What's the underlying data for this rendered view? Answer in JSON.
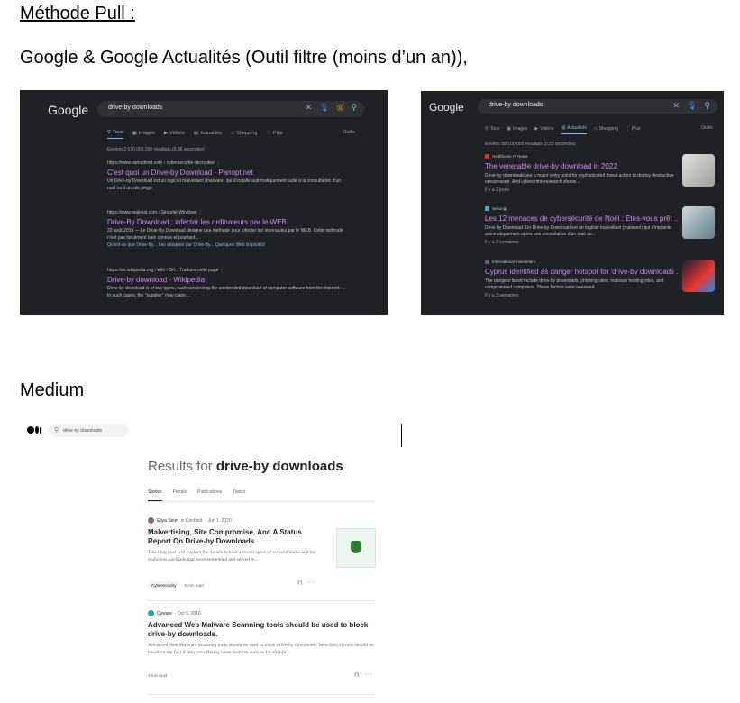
{
  "doc": {
    "title": "Méthode Pull :",
    "subtitle": "Google & Google Actualités (Outil filtre (moins d’un an)),",
    "medium_heading": "Medium"
  },
  "google_web": {
    "logo": "Google",
    "query": "drive-by downloads",
    "tabs": [
      {
        "icon": "search-icon",
        "label": "Tous",
        "active": true
      },
      {
        "icon": "image-icon",
        "label": "Images",
        "active": false
      },
      {
        "icon": "video-icon",
        "label": "Vidéos",
        "active": false
      },
      {
        "icon": "news-icon",
        "label": "Actualités",
        "active": false
      },
      {
        "icon": "tag-icon",
        "label": "Shopping",
        "active": false
      },
      {
        "icon": "more-icon",
        "label": "Plus",
        "active": false
      }
    ],
    "tools": "Outils",
    "count": "Environ 2 070 000 000 résultats (0,36 secondes)",
    "results": [
      {
        "source": "https://www.panoptinet.com › cybersecurite-decryptee   ⋮",
        "title": "C'est quoi un Drive-by Download - Panoptinet",
        "snippet": "Un Drive-by Download est un logiciel malveillant (malware) qui s'installe automatiquement suite à la consultation d'un mail ou d'un site piégé.",
        "links": ""
      },
      {
        "source": "https://www.malekal.com › Sécurité Windows   ⋮",
        "title": "Drive-By Download : infecter les ordinateurs par le WEB",
        "snippet": "29 août 2019 — Le Drive-By Download désigne une méthode pour infecter les internautes par le WEB. Cette méthode n'est pas forcément bien connue et pourtant ...",
        "links": "Qu'est-ce que Drive-By...   Les attaques par Drive-By...   Quelques Web ExploitKit"
      },
      {
        "source": "https://en.wikipedia.org › wiki › Dri...   Traduire cette page   ⋮",
        "title": "Drive-by download - Wikipedia",
        "snippet": "Drive-by download is of two types, each concerning the unintended download of computer software from the Internet: ... In such cases, the \"supplier\" may claim ...",
        "links": ""
      }
    ]
  },
  "google_news": {
    "logo": "Google",
    "query": "drive-by downloads",
    "tabs": [
      {
        "icon": "search-icon",
        "label": "Tous",
        "active": false
      },
      {
        "icon": "image-icon",
        "label": "Images",
        "active": false
      },
      {
        "icon": "video-icon",
        "label": "Vidéos",
        "active": false
      },
      {
        "icon": "news-icon",
        "label": "Actualités",
        "active": true
      },
      {
        "icon": "tag-icon",
        "label": "Shopping",
        "active": false
      },
      {
        "icon": "more-icon",
        "label": "Plus",
        "active": false
      }
    ],
    "tools": "Outils",
    "count": "Environ 88 100 000 résultats (0,25 secondes)",
    "items": [
      {
        "source": "Healthcare IT News",
        "title": "The venerable drive-by download in 2022",
        "snippet": "Drive-by downloads are a major entry point for sophisticated threat actors to deploy destructive ransomware. And cybercrime research shows...",
        "ago": "Il y a 2 jours",
        "favicon_color": "#d93025",
        "thumb_color": "#c9c9c9"
      },
      {
        "source": "Sekurigi",
        "title": "Les 12 menaces de cybersécurité de Noël : Êtes-vous prêt ...",
        "snippet": "Drive by Download. Un Drive-by Download est un logiciel malveillant (malware) qui s'implante automatiquement après une consultation d'un mail ou...",
        "ago": "Il y a 2 semaines",
        "favicon_color": "#4aa3df",
        "thumb_color": "#8aa0b0"
      },
      {
        "source": "International Investment",
        "title": "Cyprus identified as danger hotspot for 'drive-by downloads ...",
        "snippet": "The dangers faced include drive-by downloads, phishing sites, malware hosting sites, and compromised computers. These factors were reviewed...",
        "ago": "Il y a 3 semaines",
        "favicon_color": "#5f6368",
        "thumb_color": "#3a2a4a"
      }
    ]
  },
  "medium": {
    "query": "drive-by downloads",
    "results_prefix": "Results for ",
    "results_query": "drive-by downloads",
    "tabs": [
      {
        "label": "Stories",
        "active": true
      },
      {
        "label": "People",
        "active": false
      },
      {
        "label": "Publications",
        "active": false
      },
      {
        "label": "Topics",
        "active": false
      }
    ],
    "articles": [
      {
        "author": "Eliya Stein",
        "pub": " in Confiant",
        "date": " · Jun 1, 2020",
        "title": "Malvertising, Site Compromise, And A Status Report On Drive-by Downloads",
        "snippet": "This blog post will explore the details behind a recent spree of website hacks and the malicious payloads that were embedded and served to...",
        "tag": "Cybersecurity",
        "read": "8 min read",
        "avatar_color": "#8d6e63",
        "thumb_color": "#2e7d32"
      },
      {
        "author": "Cyware",
        "pub": "",
        "date": " · Oct 5, 2016",
        "title": "Advanced Web Malware Scanning tools should be used to block drive-by downloads.",
        "snippet": "Advanced Web Malware Scanning tools should be used to block drive-by downloads. Selection of tools should be based on the fact if they are offering latest features such as JavaScript...",
        "tag": "",
        "read": "1 min read",
        "avatar_color": "#26a69a",
        "thumb_color": ""
      }
    ]
  }
}
